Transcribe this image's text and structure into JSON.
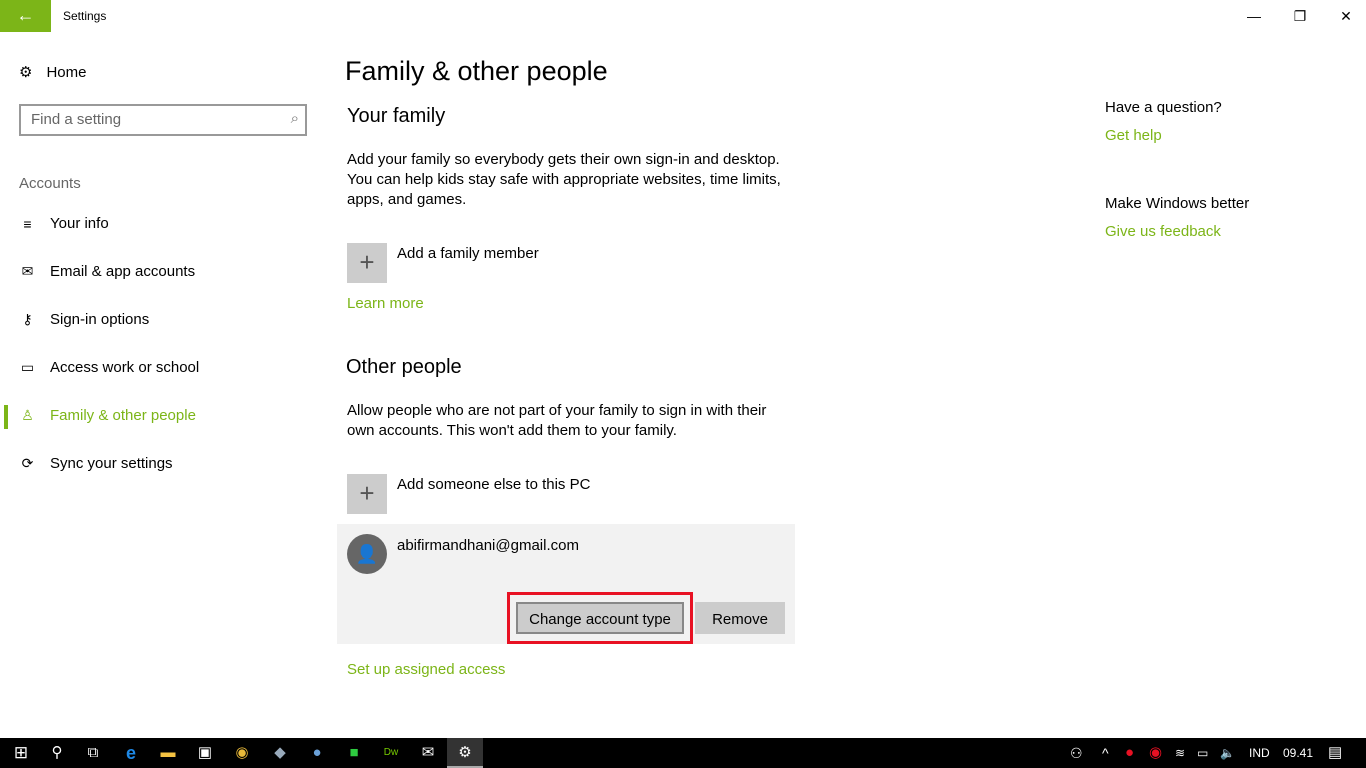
{
  "window": {
    "title": "Settings",
    "back": "←",
    "minimize": "—",
    "maximize": "❐",
    "close": "✕"
  },
  "sidebar": {
    "home": "Home",
    "search_placeholder": "Find a setting",
    "section": "Accounts",
    "items": [
      {
        "label": "Your info",
        "icon": "≡"
      },
      {
        "label": "Email & app accounts",
        "icon": "✉"
      },
      {
        "label": "Sign-in options",
        "icon": "⚷"
      },
      {
        "label": "Access work or school",
        "icon": "▭"
      },
      {
        "label": "Family & other people",
        "icon": "♙"
      },
      {
        "label": "Sync your settings",
        "icon": "⟳"
      }
    ]
  },
  "main": {
    "title": "Family & other people",
    "family_heading": "Your family",
    "family_desc": "Add your family so everybody gets their own sign-in and desktop. You can help kids stay safe with appropriate websites, time limits, apps, and games.",
    "add_family": "Add a family member",
    "learn_more": "Learn more",
    "other_heading": "Other people",
    "other_desc": "Allow people who are not part of your family to sign in with their own accounts. This won't add them to your family.",
    "add_other": "Add someone else to this PC",
    "account_email": "abifirmandhani@gmail.com",
    "change_type": "Change account type",
    "remove": "Remove",
    "assigned_access": "Set up assigned access"
  },
  "right": {
    "question": "Have a question?",
    "get_help": "Get help",
    "better": "Make Windows better",
    "feedback": "Give us feedback"
  },
  "taskbar": {
    "language": "IND",
    "time": "09.41"
  },
  "colors": {
    "accent": "#7cb518",
    "highlight": "#e81123"
  }
}
